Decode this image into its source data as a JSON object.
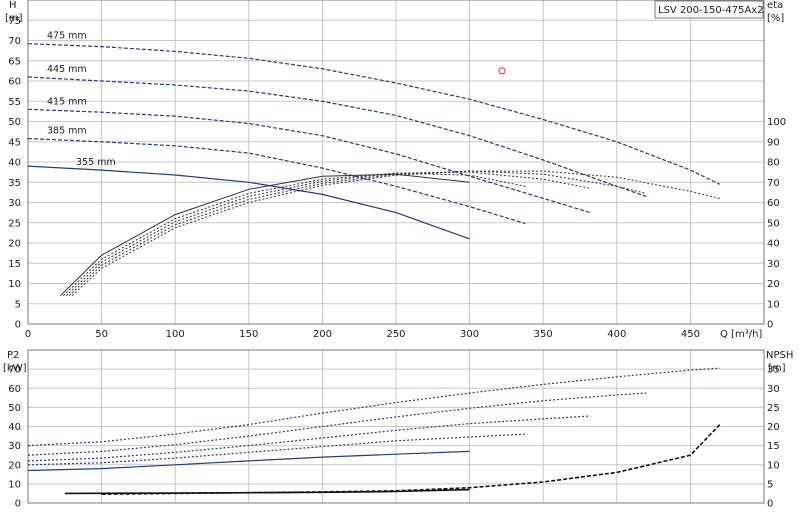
{
  "chart_data": [
    {
      "type": "line",
      "title": "LSV 200-150-475Ax2",
      "xlabel": "Q [m³/h]",
      "ylabel_left": [
        "H",
        "[m]"
      ],
      "ylabel_right": [
        "eta",
        "[%]"
      ],
      "xlim": [
        0,
        500
      ],
      "ylim_left": [
        0,
        80
      ],
      "ylim_right": [
        0,
        160
      ],
      "x_ticks": [
        "0",
        "50",
        "100",
        "150",
        "200",
        "250",
        "300",
        "350",
        "400",
        "450"
      ],
      "y_ticks_left": [
        "0",
        "5",
        "10",
        "15",
        "20",
        "25",
        "30",
        "35",
        "40",
        "45",
        "50",
        "55",
        "60",
        "65",
        "70",
        "75"
      ],
      "y_ticks_right": [
        "0",
        "10",
        "20",
        "30",
        "40",
        "50",
        "60",
        "70",
        "80",
        "90",
        "100"
      ],
      "grid": true,
      "head_series": [
        {
          "name": "475 mm",
          "color": "#1f3f7a",
          "dash": "4,2",
          "x": [
            0,
            50,
            100,
            150,
            200,
            250,
            300,
            350,
            400,
            450,
            470
          ],
          "y": [
            69.2,
            68.5,
            67.3,
            65.6,
            63.0,
            59.5,
            55.5,
            50.5,
            45.0,
            38.0,
            34.5
          ]
        },
        {
          "name": "445 mm",
          "color": "#1f3f7a",
          "dash": "4,2",
          "x": [
            0,
            50,
            100,
            150,
            200,
            250,
            300,
            350,
            400,
            420
          ],
          "y": [
            61.0,
            60.0,
            59.0,
            57.5,
            55.0,
            51.5,
            46.5,
            40.5,
            34.0,
            31.5
          ]
        },
        {
          "name": "415 mm",
          "color": "#1f3f7a",
          "dash": "4,2",
          "x": [
            0,
            50,
            100,
            150,
            200,
            250,
            300,
            350,
            382
          ],
          "y": [
            53.0,
            52.3,
            51.3,
            49.5,
            46.5,
            42.0,
            36.5,
            31.0,
            27.5
          ]
        },
        {
          "name": "385 mm",
          "color": "#1f3f7a",
          "dash": "4,2",
          "x": [
            0,
            50,
            100,
            150,
            200,
            250,
            300,
            338
          ],
          "y": [
            45.8,
            45.0,
            44.0,
            42.2,
            38.5,
            34.0,
            29.0,
            24.8
          ]
        },
        {
          "name": "355 mm",
          "color": "#1f3f7a",
          "dash": "",
          "x": [
            0,
            50,
            100,
            150,
            200,
            250,
            300
          ],
          "y": [
            39.0,
            38.0,
            36.8,
            35.0,
            32.0,
            27.5,
            21.0
          ]
        }
      ],
      "efficiency_series": [
        {
          "color": "#333333",
          "dash": "",
          "x": [
            22,
            50,
            100,
            150,
            200,
            250,
            300
          ],
          "y": [
            14.0,
            34.0,
            54.0,
            66.5,
            73.0,
            74.0,
            70.0
          ]
        },
        {
          "color": "#333333",
          "dash": "2,2",
          "x": [
            24,
            50,
            100,
            150,
            200,
            250,
            300,
            338
          ],
          "y": [
            14.0,
            32.0,
            52.0,
            64.5,
            71.5,
            74.5,
            73.5,
            68.0
          ]
        },
        {
          "color": "#333333",
          "dash": "2,2",
          "x": [
            26,
            50,
            100,
            150,
            200,
            250,
            300,
            350,
            382
          ],
          "y": [
            14.0,
            30.5,
            50.5,
            63.0,
            70.5,
            74.5,
            75.0,
            71.5,
            67.0
          ]
        },
        {
          "color": "#333333",
          "dash": "2,2",
          "x": [
            28,
            50,
            100,
            150,
            200,
            250,
            300,
            350,
            400,
            420
          ],
          "y": [
            14.0,
            29.0,
            49.0,
            61.5,
            69.5,
            74.0,
            75.5,
            74.0,
            68.0,
            64.5
          ]
        },
        {
          "color": "#333333",
          "dash": "2,2",
          "x": [
            30,
            50,
            100,
            150,
            200,
            250,
            300,
            350,
            400,
            450,
            470
          ],
          "y": [
            14.0,
            27.5,
            47.5,
            60.0,
            68.5,
            73.5,
            75.5,
            75.5,
            72.5,
            65.5,
            62.0
          ]
        }
      ],
      "annotations": [
        {
          "x": 322,
          "y": 62.5,
          "marker": "circle",
          "color": "#e03030"
        }
      ]
    },
    {
      "type": "line",
      "xlim": [
        0,
        500
      ],
      "ylabel_left": [
        "P2",
        "[kW]"
      ],
      "ylabel_right": [
        "NPSH",
        "[m]"
      ],
      "ylim_left": [
        0,
        80
      ],
      "ylim_right": [
        0,
        40
      ],
      "y_ticks_left": [
        "0",
        "10",
        "20",
        "30",
        "40",
        "50",
        "60",
        "70"
      ],
      "y_ticks_right": [
        "0",
        "5",
        "10",
        "15",
        "20",
        "25",
        "30",
        "35"
      ],
      "grid": true,
      "power_series": [
        {
          "color": "#1f3f7a",
          "dash": "2,2",
          "x": [
            0,
            50,
            100,
            150,
            200,
            250,
            300,
            350,
            400,
            450,
            470
          ],
          "y": [
            30.0,
            32.0,
            36.0,
            41.0,
            47.0,
            52.5,
            57.5,
            62.0,
            66.0,
            69.5,
            70.5
          ]
        },
        {
          "color": "#1f3f7a",
          "dash": "2,2",
          "x": [
            0,
            50,
            100,
            150,
            200,
            250,
            300,
            350,
            400,
            420
          ],
          "y": [
            25.0,
            27.0,
            30.5,
            35.0,
            40.0,
            45.0,
            49.5,
            53.5,
            56.5,
            57.5
          ]
        },
        {
          "color": "#1f3f7a",
          "dash": "2,2",
          "x": [
            0,
            50,
            100,
            150,
            200,
            250,
            300,
            350,
            382
          ],
          "y": [
            22.0,
            23.5,
            26.5,
            30.0,
            34.0,
            38.0,
            41.5,
            44.0,
            45.5
          ]
        },
        {
          "color": "#1f3f7a",
          "dash": "2,2",
          "x": [
            0,
            50,
            100,
            150,
            200,
            250,
            300,
            338
          ],
          "y": [
            20.0,
            21.0,
            23.5,
            26.5,
            29.5,
            32.5,
            34.5,
            36.0
          ]
        },
        {
          "color": "#1f3f7a",
          "dash": "",
          "x": [
            0,
            50,
            100,
            150,
            200,
            250,
            300
          ],
          "y": [
            17.0,
            18.0,
            20.0,
            22.0,
            24.0,
            25.5,
            27.0
          ]
        }
      ],
      "npsh_series": [
        {
          "color": "#111111",
          "dash": "",
          "x": [
            25,
            100,
            200,
            250,
            300
          ],
          "y": [
            2.5,
            2.6,
            2.8,
            3.0,
            3.5
          ]
        },
        {
          "color": "#111111",
          "dash": "4,2",
          "x": [
            50,
            100,
            150,
            200,
            250,
            300,
            350,
            400,
            450,
            470
          ],
          "y": [
            2.3,
            2.5,
            2.7,
            2.9,
            3.2,
            4.0,
            5.5,
            8.0,
            12.5,
            20.5
          ]
        }
      ]
    }
  ]
}
